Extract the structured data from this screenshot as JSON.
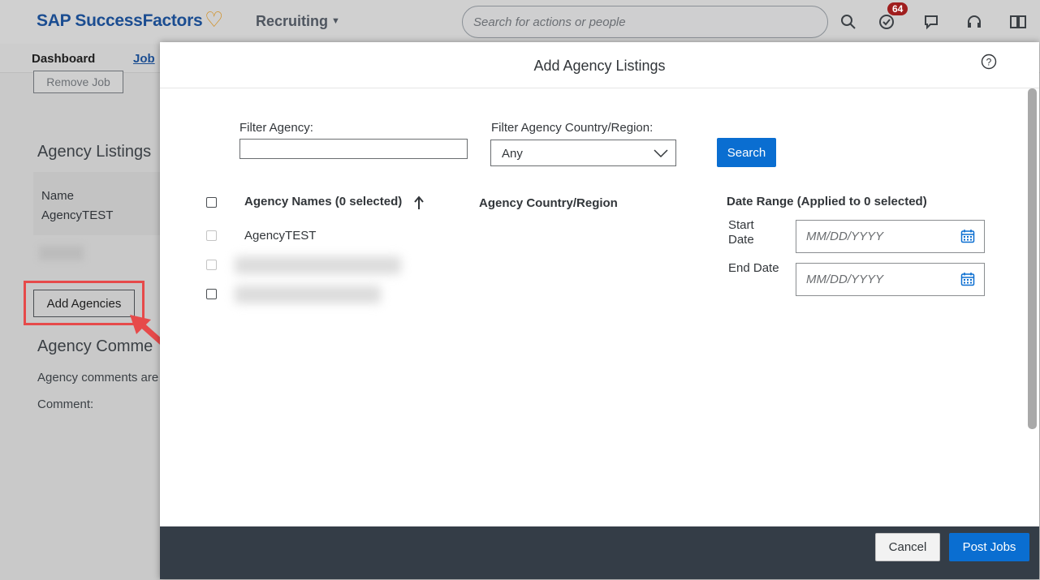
{
  "header": {
    "logo_text": "SAP SuccessFactors",
    "module": "Recruiting",
    "search_placeholder": "Search for actions or people",
    "notifications_count": "64"
  },
  "subnav": {
    "tab_dashboard": "Dashboard",
    "tab_job": "Job"
  },
  "background": {
    "remove_job": "Remove Job",
    "agency_listings_title": "Agency Listings",
    "table_header_name": "Name",
    "table_row_1": "AgencyTEST",
    "add_agencies": "Add Agencies",
    "agency_comments_title": "Agency Comme",
    "agency_comments_text": "Agency comments are",
    "comment_label": "Comment:"
  },
  "modal": {
    "title": "Add Agency Listings",
    "filter_agency_label": "Filter Agency:",
    "filter_agency_value": "",
    "filter_country_label": "Filter Agency Country/Region:",
    "filter_country_value": "Any",
    "search_button": "Search",
    "col_agency_names": "Agency Names (0 selected)",
    "col_country": "Agency Country/Region",
    "col_date_range": "Date Range (Applied to 0 selected)",
    "rows": [
      "AgencyTEST"
    ],
    "start_date_label_1": "Start",
    "start_date_label_2": "Date",
    "end_date_label": "End Date",
    "date_placeholder": "MM/DD/YYYY",
    "cancel_button": "Cancel",
    "post_jobs_button": "Post Jobs"
  },
  "colors": {
    "primary": "#0a6ed1",
    "footer": "#343d47",
    "callout": "#e64a4a"
  }
}
